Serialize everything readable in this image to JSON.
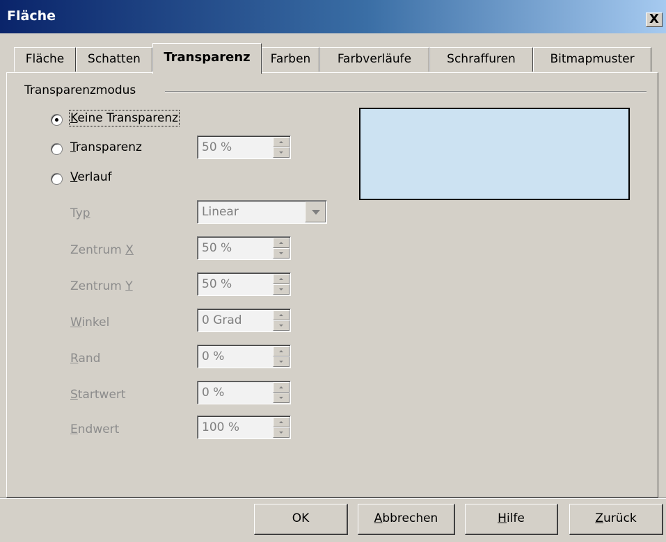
{
  "window": {
    "title": "Fläche",
    "close_label": "X"
  },
  "tabs": [
    {
      "label": "Fläche"
    },
    {
      "label": "Schatten"
    },
    {
      "label": "Transparenz",
      "active": true
    },
    {
      "label": "Farben"
    },
    {
      "label": "Farbverläufe"
    },
    {
      "label": "Schraffuren"
    },
    {
      "label": "Bitmapmuster"
    }
  ],
  "group": {
    "label": "Transparenzmodus"
  },
  "radios": {
    "none": {
      "prefix": "",
      "key": "K",
      "rest": "eine Transparenz",
      "checked": true
    },
    "transparency": {
      "prefix": "",
      "key": "T",
      "rest": "ransparenz",
      "value": "50 %"
    },
    "gradient": {
      "prefix": "",
      "key": "V",
      "rest": "erlauf"
    }
  },
  "gradient": {
    "type": {
      "label_pre": "Ty",
      "label_key": "p",
      "label_post": "",
      "value": "Linear"
    },
    "center_x": {
      "label_pre": "Zentrum ",
      "label_key": "X",
      "label_post": "",
      "value": "50 %"
    },
    "center_y": {
      "label_pre": "Zentrum ",
      "label_key": "Y",
      "label_post": "",
      "value": "50 %"
    },
    "angle": {
      "label_pre": "",
      "label_key": "W",
      "label_post": "inkel",
      "value": "0 Grad"
    },
    "border": {
      "label_pre": "",
      "label_key": "R",
      "label_post": "and",
      "value": "0 %"
    },
    "start": {
      "label_pre": "",
      "label_key": "S",
      "label_post": "tartwert",
      "value": "0 %"
    },
    "end": {
      "label_pre": "",
      "label_key": "E",
      "label_post": "ndwert",
      "value": "100 %"
    }
  },
  "preview": {
    "color": "#cce2f2"
  },
  "buttons": {
    "ok": "OK",
    "cancel": {
      "key": "A",
      "rest": "bbrechen"
    },
    "help": {
      "key": "H",
      "rest": "ilfe"
    },
    "back": {
      "key": "Z",
      "rest": "urück"
    }
  }
}
